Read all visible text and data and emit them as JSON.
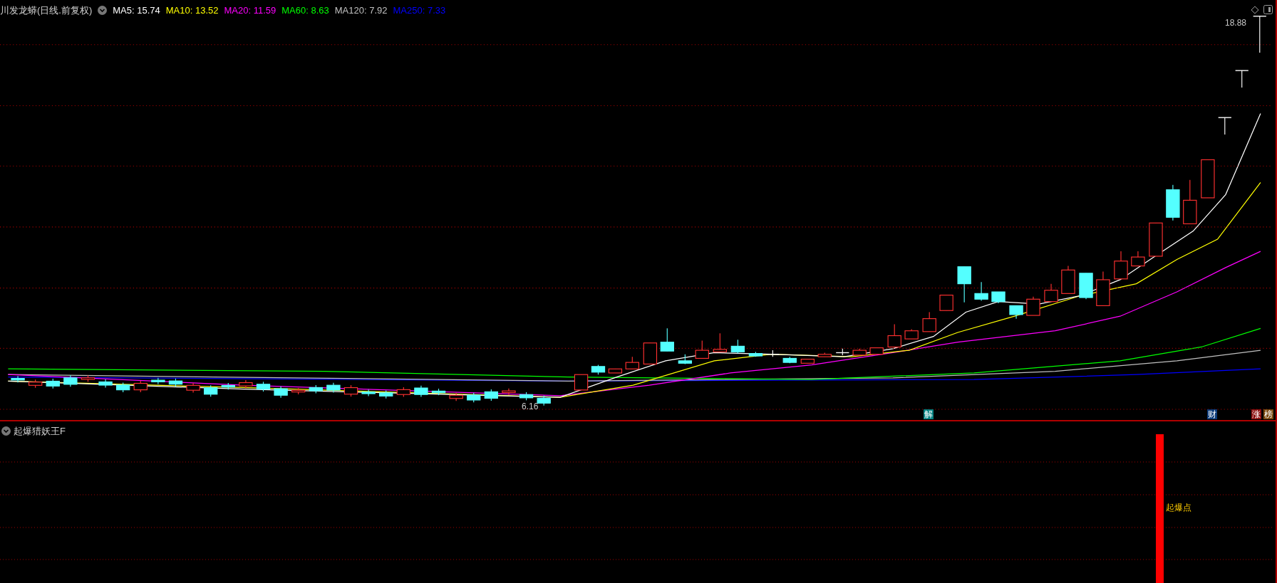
{
  "main_chart": {
    "title": "川发龙蟒(日线.前复权)",
    "ma_values": [
      {
        "text": "MA5: 15.74",
        "color": "#ffffff"
      },
      {
        "text": "MA10: 13.52",
        "color": "#ffff00"
      },
      {
        "text": "MA20: 11.59",
        "color": "#ff00ff"
      },
      {
        "text": "MA60: 8.63",
        "color": "#00ff00"
      },
      {
        "text": "MA120: 7.92",
        "color": "#c0c0c0"
      },
      {
        "text": "MA250: 7.33",
        "color": "#0000ff"
      }
    ],
    "high_label": "18.88",
    "low_label": "6.16",
    "markers": [
      {
        "text": "解",
        "color": "#008080"
      },
      {
        "text": "财",
        "color": "#0b3a78"
      },
      {
        "text": "涨",
        "color": "#8b1010"
      },
      {
        "text": "榜",
        "color": "#7a4a10"
      }
    ]
  },
  "indicator_panel": {
    "title": "起爆猎妖王F",
    "signal_label": "起爆点"
  }
}
